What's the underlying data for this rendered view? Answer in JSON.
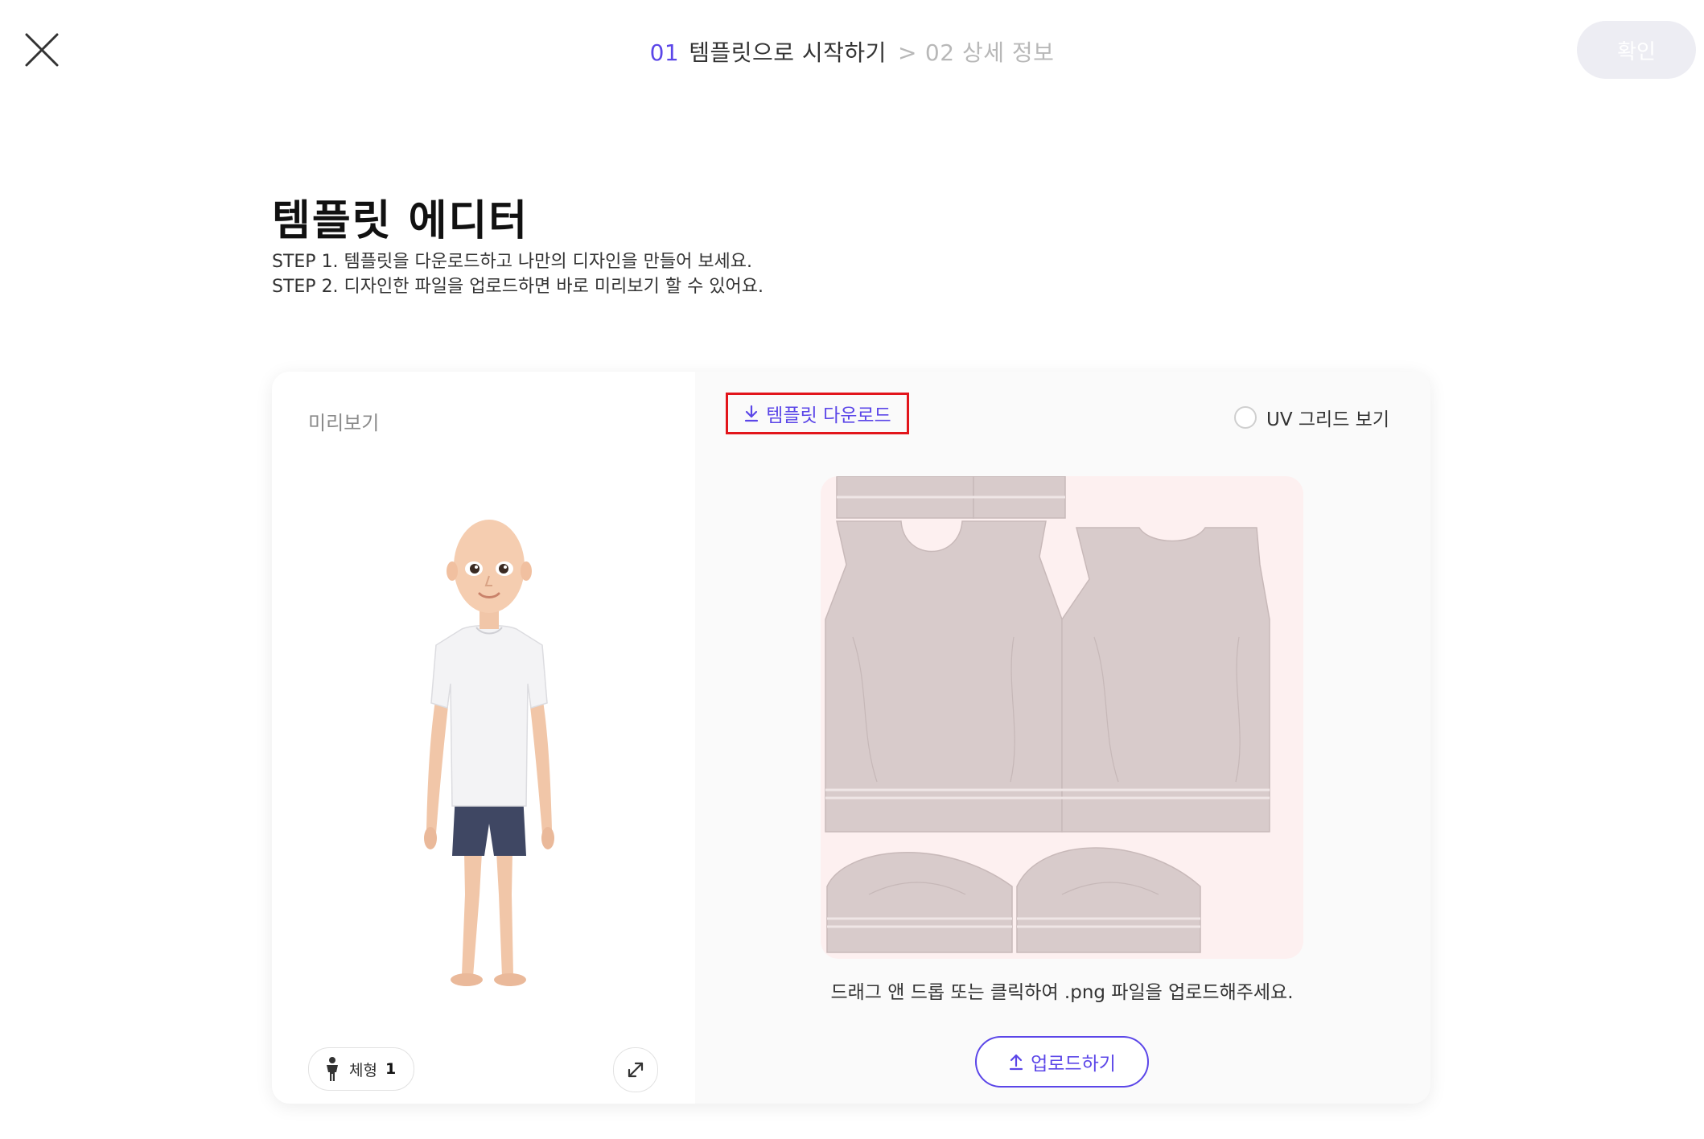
{
  "header": {
    "close_icon": "close-icon",
    "steps": [
      {
        "number": "01",
        "label": "템플릿으로 시작하기",
        "active": true
      },
      {
        "number": "02",
        "label": "상세 정보",
        "active": false
      }
    ],
    "separator": ">",
    "confirm_label": "확인"
  },
  "page": {
    "title": "템플릿 에디터",
    "step1": "STEP 1. 템플릿을 다운로드하고 나만의 디자인을 만들어 보세요.",
    "step2": "STEP 2. 디자인한 파일을 업로드하면 바로 미리보기 할 수 있어요."
  },
  "preview": {
    "label": "미리보기",
    "bodytype_label": "체형",
    "bodytype_value": "1",
    "expand_icon": "expand-icon"
  },
  "editor": {
    "download_label": "템플릿 다운로드",
    "uv_grid_label": "UV 그리드 보기",
    "uv_grid_checked": false,
    "drop_hint": "드래그 앤 드롭 또는 클릭하여 .png 파일을 업로드해주세요.",
    "upload_label": "업로드하기"
  },
  "colors": {
    "accent": "#5b46e8",
    "highlight_border": "#e2151b",
    "confirm_disabled_bg": "#ededf3",
    "template_bg": "#fdf0f0",
    "template_piece": "#d8cbcb"
  }
}
